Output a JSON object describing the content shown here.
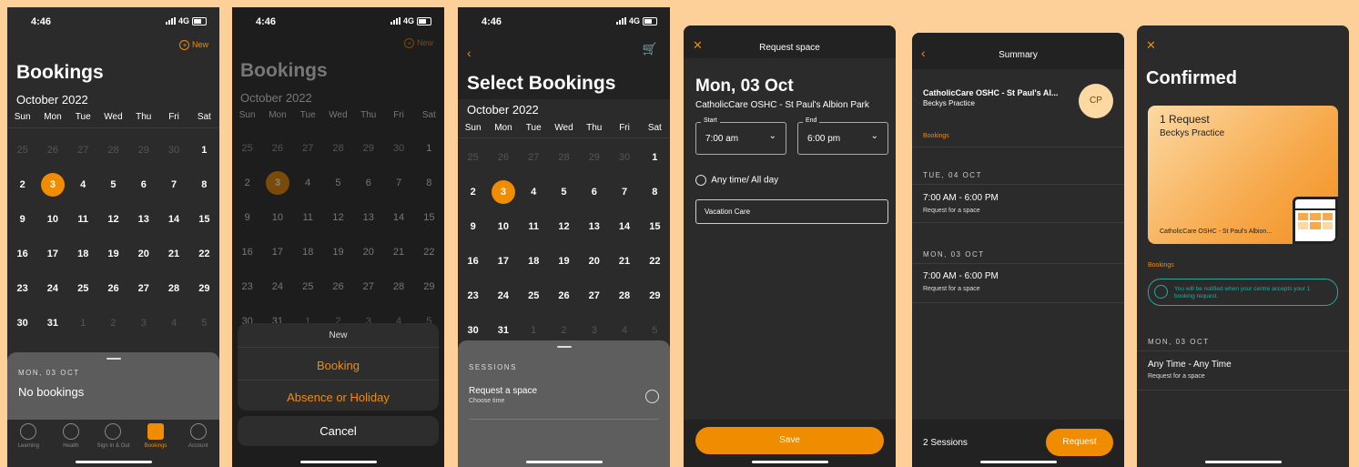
{
  "status": {
    "time": "4:46",
    "network": "4G"
  },
  "calendar": {
    "month": "October 2022",
    "weekdays": [
      "Sun",
      "Mon",
      "Tue",
      "Wed",
      "Thu",
      "Fri",
      "Sat"
    ],
    "weeks": [
      [
        "25",
        "26",
        "27",
        "28",
        "29",
        "30",
        "1"
      ],
      [
        "2",
        "3",
        "4",
        "5",
        "6",
        "7",
        "8"
      ],
      [
        "9",
        "10",
        "11",
        "12",
        "13",
        "14",
        "15"
      ],
      [
        "16",
        "17",
        "18",
        "19",
        "20",
        "21",
        "22"
      ],
      [
        "23",
        "24",
        "25",
        "26",
        "27",
        "28",
        "29"
      ],
      [
        "30",
        "31",
        "1",
        "2",
        "3",
        "4",
        "5"
      ]
    ]
  },
  "screen1": {
    "new_label": "New",
    "title": "Bookings",
    "sheet_date": "MON, 03 OCT",
    "sheet_text": "No bookings",
    "tabs": [
      "Learning",
      "Health",
      "Sign In & Out",
      "Bookings",
      "Account"
    ]
  },
  "screen2": {
    "new_label": "New",
    "title": "Bookings",
    "menu_title": "New",
    "option1": "Booking",
    "option2": "Absence or Holiday",
    "cancel": "Cancel"
  },
  "screen3": {
    "title": "Select Bookings",
    "sessions_header": "SESSIONS",
    "session_title": "Request a space",
    "session_sub": "Choose time"
  },
  "screen4": {
    "header": "Request space",
    "date": "Mon, 03 Oct",
    "centre": "CatholicCare OSHC - St Paul's Albion Park",
    "start_label": "Start",
    "start_value": "7:00 am",
    "end_label": "End",
    "end_value": "6:00 pm",
    "any_time": "Any time/ All day",
    "care_type": "Vacation Care",
    "save": "Save"
  },
  "screen5": {
    "header": "Summary",
    "centre": "CatholicCare OSHC - St Paul's Al...",
    "practice": "Beckys Practice",
    "initials": "CP",
    "bookings_link": "Bookings",
    "items": [
      {
        "date": "TUE, 04 OCT",
        "time": "7:00 AM - 6:00 PM",
        "sub": "Request for a space"
      },
      {
        "date": "MON, 03 OCT",
        "time": "7:00 AM - 6:00 PM",
        "sub": "Request for a space"
      }
    ],
    "sessions_count": "2 Sessions",
    "request_button": "Request"
  },
  "screen6": {
    "title": "Confirmed",
    "card_title": "1 Request",
    "card_sub": "Beckys Practice",
    "card_footer": "CatholicCare OSHC - St Paul's Albion...",
    "bookings_link": "Bookings",
    "notice": "You will be notified when your centre accepts your 1 booking request.",
    "date": "MON, 03 OCT",
    "time": "Any Time - Any Time",
    "sub": "Request for a space"
  },
  "colors": {
    "accent": "#f08c00",
    "background": "#fdcf99",
    "panel": "#2b2b2b"
  }
}
